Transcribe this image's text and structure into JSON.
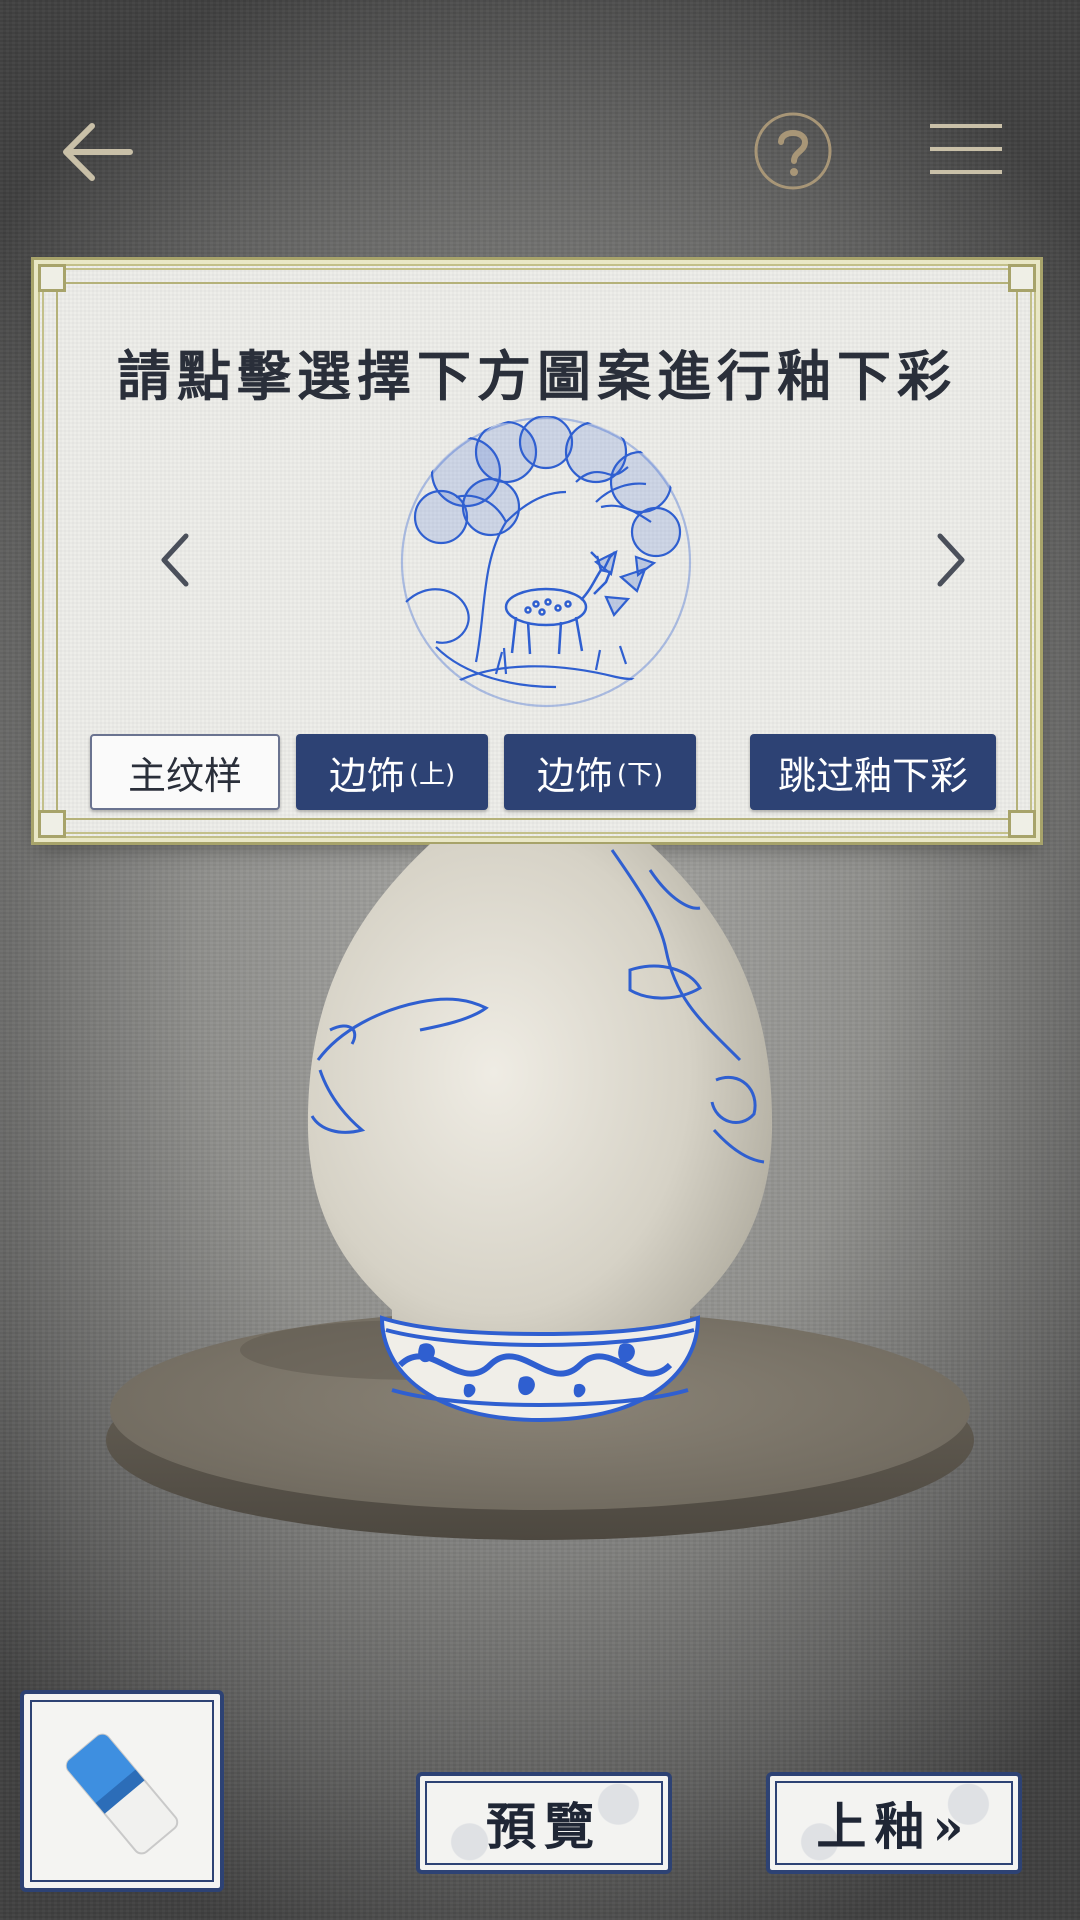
{
  "panel": {
    "title": "請點擊選擇下方圖案進行釉下彩",
    "tabs": {
      "main": "主纹样",
      "border_top": "边饰",
      "border_top_suffix": "(上)",
      "border_bottom": "边饰",
      "border_bottom_suffix": "(下)",
      "skip": "跳过釉下彩"
    }
  },
  "bottom": {
    "preview_label": "預覽",
    "glaze_label": "上釉»"
  },
  "colors": {
    "accent_blue": "#2d4274",
    "porcelain_blue": "#2f5fd0",
    "frame_gold": "#b5b27a"
  },
  "icons": {
    "back": "arrow-left-icon",
    "help": "question-circle-icon",
    "menu": "hamburger-menu-icon",
    "prev": "chevron-left-icon",
    "next": "chevron-right-icon",
    "eraser": "eraser-icon"
  }
}
